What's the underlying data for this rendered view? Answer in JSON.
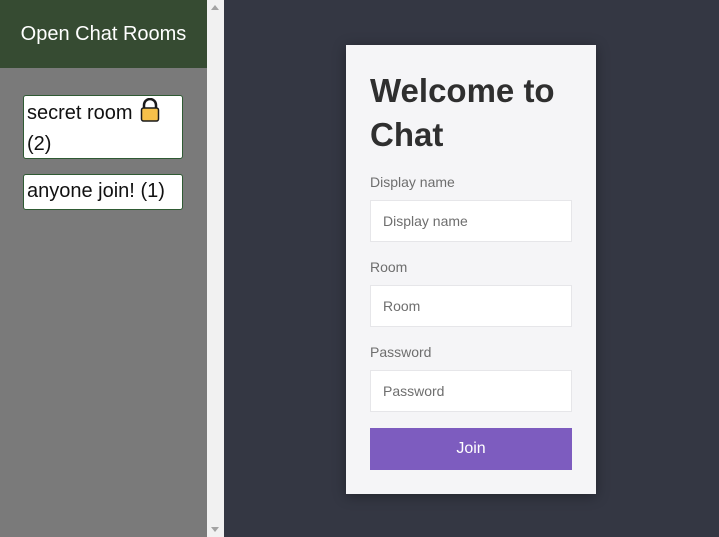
{
  "sidebar": {
    "title": "Open Chat Rooms",
    "rooms": [
      {
        "name": "secret room",
        "locked": true,
        "count": "(2)",
        "icon": "lock-icon"
      },
      {
        "name": "anyone join!",
        "locked": false,
        "count": "(1)"
      }
    ]
  },
  "form": {
    "title": "Welcome to Chat",
    "display_name_label": "Display name",
    "display_name_placeholder": "Display name",
    "display_name_value": "",
    "room_label": "Room",
    "room_placeholder": "Room",
    "room_value": "",
    "password_label": "Password",
    "password_placeholder": "Password",
    "password_value": "",
    "join_label": "Join"
  },
  "colors": {
    "sidebar_header_bg": "#364b32",
    "sidebar_bg": "#7a7a7a",
    "page_bg": "#343743",
    "card_bg": "#f5f5f7",
    "accent": "#7d5cbf",
    "room_border": "#2f5a33",
    "lock": "#f5c04a"
  }
}
